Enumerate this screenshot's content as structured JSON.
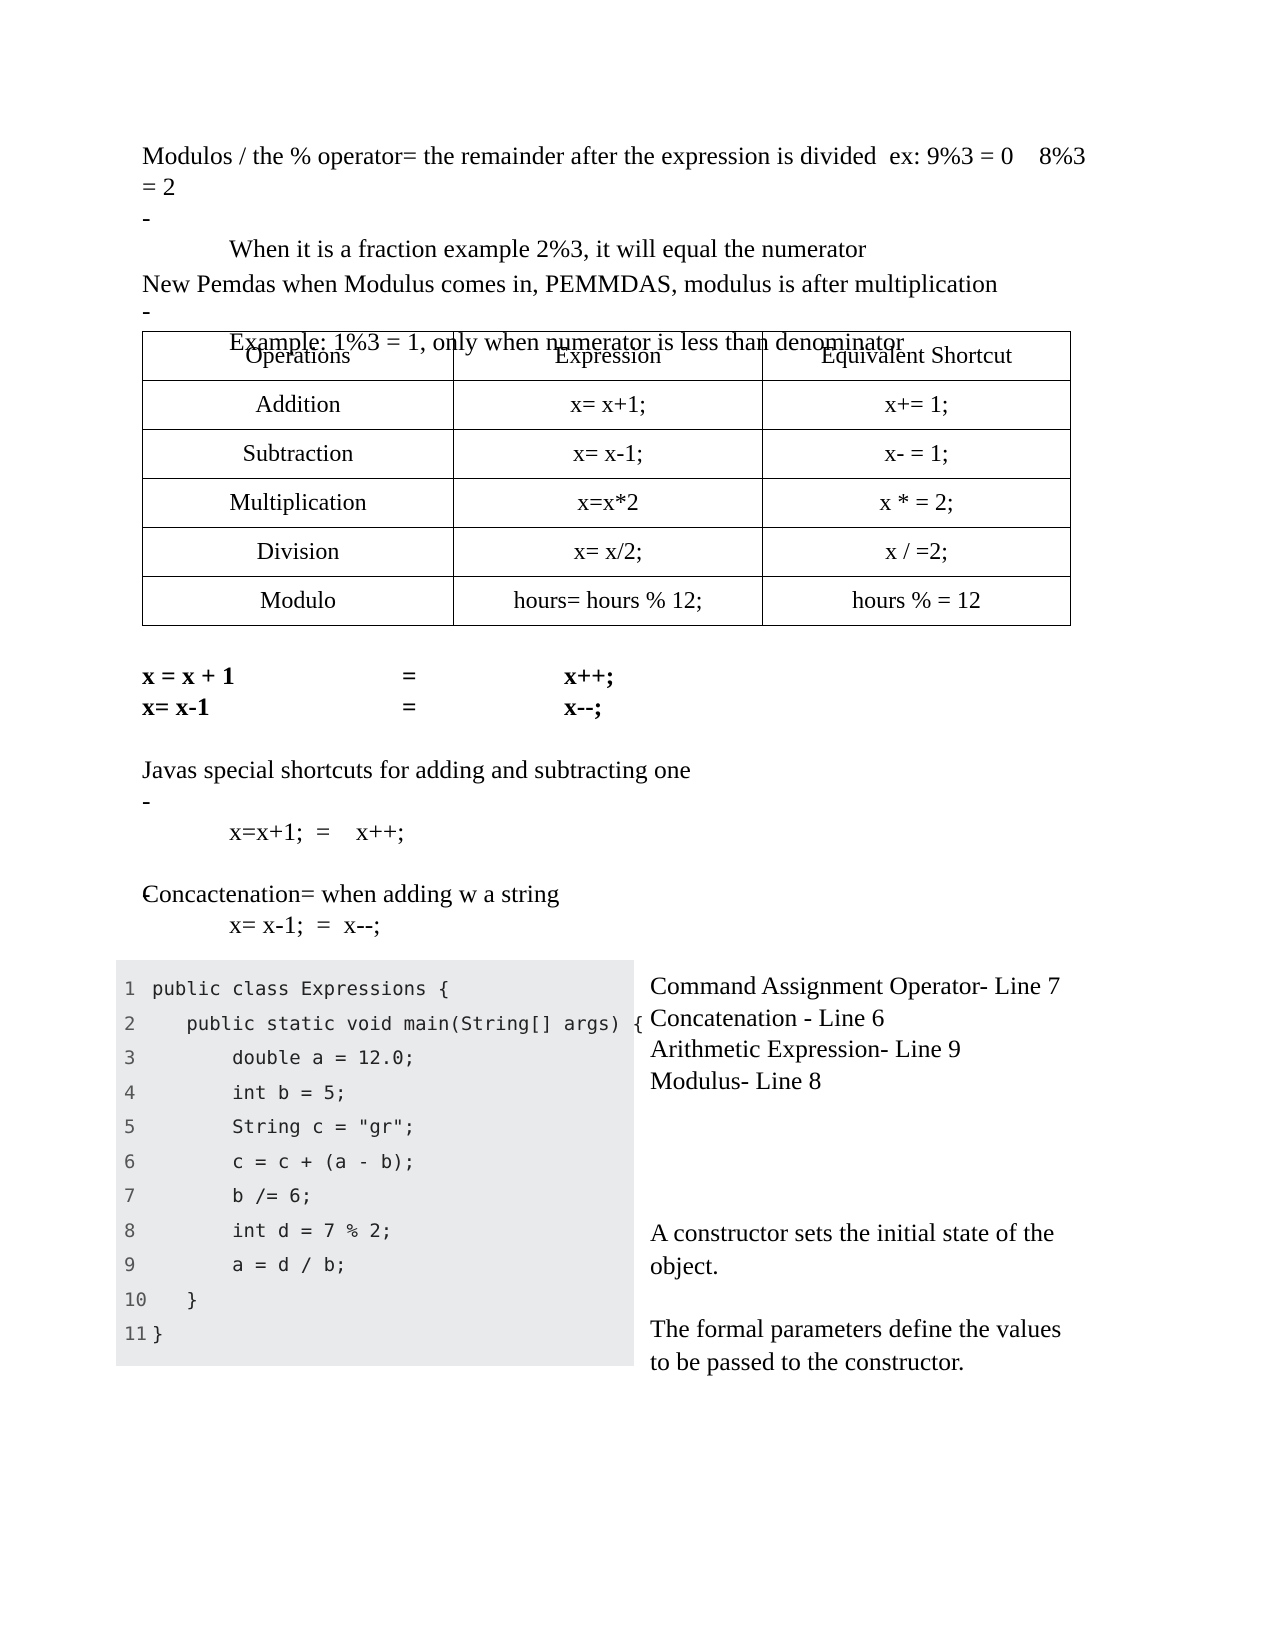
{
  "document": {
    "intro": {
      "heading": "Modulos / the % operator= the remainder after the expression is divided  ex: 9%3 = 0    8%3 = 2",
      "bullets": [
        "When it is a fraction example 2%3, it will equal the numerator",
        "Example: 1%3 = 1, only when numerator is less than denominator"
      ],
      "dash": "-"
    },
    "pemdas_note": "New Pemdas when Modulus comes in, PEMMDAS, modulus is after multiplication",
    "table": {
      "headers": [
        "Operations",
        "Expression",
        "Equivalent Shortcut"
      ],
      "rows": [
        [
          "Addition",
          "x= x+1;",
          "x+= 1;"
        ],
        [
          "Subtraction",
          "x= x-1;",
          "x- = 1;"
        ],
        [
          "Multiplication",
          "x=x*2",
          "x * = 2;"
        ],
        [
          "Division",
          "x= x/2;",
          "x / =2;"
        ],
        [
          "Modulo",
          "hours= hours % 12;",
          "hours % = 12"
        ]
      ]
    },
    "equivalences": [
      {
        "lhs": "x = x + 1",
        "eq": "=",
        "rhs": "x++;"
      },
      {
        "lhs": "x= x-1",
        "eq": "=",
        "rhs": "x--;"
      }
    ],
    "shortcuts": {
      "heading": "Javas special shortcuts for adding and subtracting one",
      "dash": "-",
      "items": [
        "x=x+1;  =    x++;",
        "x= x-1;  =  x--;"
      ]
    },
    "concatenation_note": "Concactenation= when adding w a string",
    "code": {
      "lines": [
        {
          "number": "1",
          "text": "public class Expressions {"
        },
        {
          "number": "2",
          "text": "   public static void main(String[] args) {"
        },
        {
          "number": "3",
          "text": "       double a = 12.0;"
        },
        {
          "number": "4",
          "text": "       int b = 5;"
        },
        {
          "number": "5",
          "text": "       String c = \"gr\";"
        },
        {
          "number": "6",
          "text": "       c = c + (a - b);"
        },
        {
          "number": "7",
          "text": "       b /= 6;"
        },
        {
          "number": "8",
          "text": "       int d = 7 % 2;"
        },
        {
          "number": "9",
          "text": "       a = d / b;"
        },
        {
          "number": "10",
          "text": "   }"
        },
        {
          "number": "11",
          "text": "}"
        }
      ],
      "background": "#e8eaec"
    },
    "notes": {
      "line_annotations": [
        "Command Assignment Operator- Line 7",
        "Concatenation - Line 6",
        "Arithmetic Expression- Line 9",
        "Modulus- Line 8"
      ],
      "constructor_note": "A constructor sets the initial state of the object.",
      "parameters_note": "The formal parameters define the values to be passed to the constructor."
    }
  }
}
